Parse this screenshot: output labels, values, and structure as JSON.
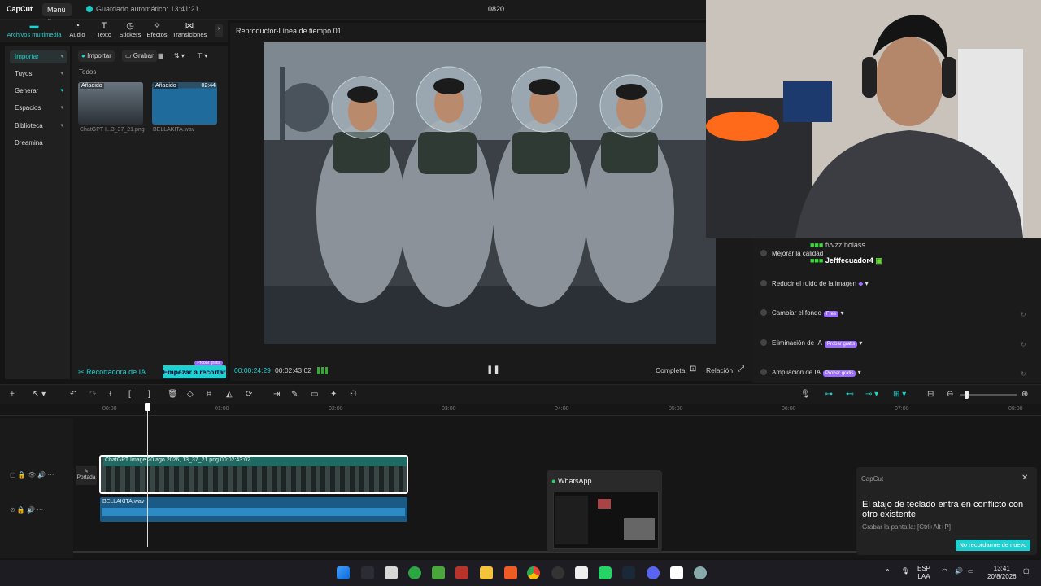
{
  "app": {
    "logo": "CapCut",
    "menu": "Menú",
    "autosave": "Guardado automático: 13:41:21",
    "project": "0820"
  },
  "toolbar": [
    {
      "label": "Archivos multimedia",
      "icon": "media-icon"
    },
    {
      "label": "Audio",
      "icon": "audio-icon"
    },
    {
      "label": "Texto",
      "icon": "text-icon"
    },
    {
      "label": "Stickers",
      "icon": "stickers-icon"
    },
    {
      "label": "Efectos",
      "icon": "effects-icon"
    },
    {
      "label": "Transiciones",
      "icon": "transitions-icon"
    }
  ],
  "nav": [
    "Importar",
    "Tuyos",
    "Generar",
    "Espacios",
    "Biblioteca",
    "Dreamina"
  ],
  "media": {
    "import": "Importar",
    "record": "Grabar",
    "section": "Todos",
    "items": [
      {
        "tag": "Añadido",
        "name": "ChatGPT I...3_37_21.png"
      },
      {
        "tag": "Añadido",
        "duration": "02:44",
        "name": "BELLAKITA.wav"
      }
    ]
  },
  "aicrop": {
    "label": "Recortadora de IA",
    "button": "Empezar a recortar",
    "badge": "Probar gratis"
  },
  "player": {
    "title": "Reproductor-Línea de tiempo 01",
    "current": "00:00:24:29",
    "total": "00:02:43:02",
    "full": "Completa",
    "ratio": "Relación"
  },
  "right": {
    "options": [
      {
        "label": "Mejorar la calidad"
      },
      {
        "label": "Reducir el ruido de la imagen"
      },
      {
        "label": "Cambiar el fondo",
        "badge": "Free"
      },
      {
        "label": "Eliminación de IA",
        "badge": "Probar gratis"
      },
      {
        "label": "Ampliación de IA",
        "badge": "Probar gratis"
      }
    ]
  },
  "chat": [
    {
      "user": "fvvzz",
      "msg": "holass"
    },
    {
      "user": "Jefffecuador4",
      "msg": ""
    }
  ],
  "timeline": {
    "ruler": [
      "00:00",
      "01:00",
      "02:00",
      "03:00",
      "04:00",
      "05:00",
      "06:00",
      "07:00",
      "08:00"
    ],
    "video_clip": "ChatGPT Image 20 ago 2026, 13_37_21.png  00:02:43:02",
    "audio_clip": "BELLAKITA.wav",
    "cover": "Portada"
  },
  "whatsapp": {
    "title": "WhatsApp"
  },
  "notification": {
    "app": "CapCut",
    "message": "El atajo de teclado entra en conflicto con otro existente",
    "sub": "Grabar la pantalla: [Ctrl+Alt+P]",
    "button": "No recordarme de nuevo"
  },
  "tray": {
    "lang": "ESP",
    "region": "LAA",
    "time": "13:41",
    "date": "20/8/2026"
  },
  "colors": {
    "accent": "#1fd1d1",
    "purple": "#9b6bff"
  }
}
